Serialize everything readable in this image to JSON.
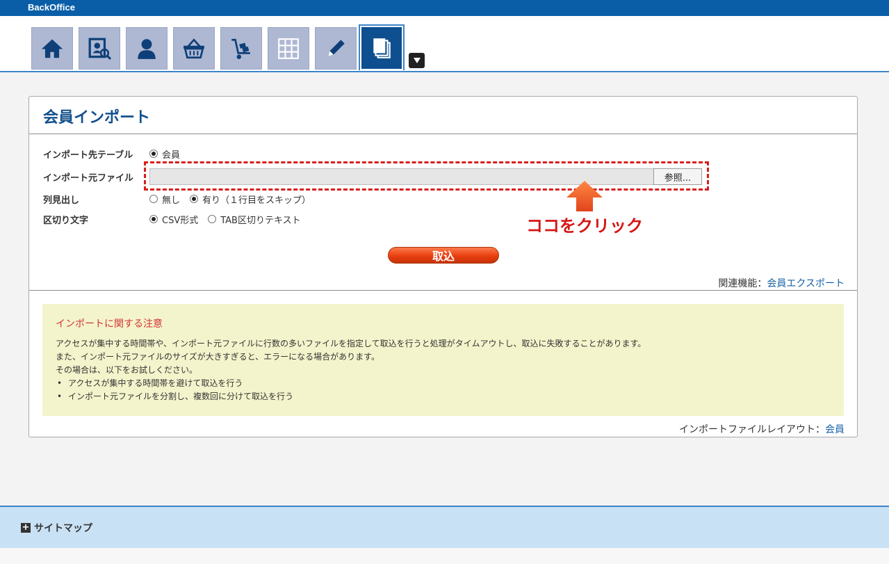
{
  "app": {
    "brand": "BackOffice"
  },
  "toolbar": {
    "icons": [
      "home-icon",
      "member-search-icon",
      "person-icon",
      "basket-icon",
      "cart-icon",
      "grid-icon",
      "pencil-icon",
      "documents-icon"
    ],
    "active": "documents-icon"
  },
  "page": {
    "title": "会員インポート"
  },
  "form": {
    "table_label": "インポート先テーブル",
    "table_option": "会員",
    "file_label": "インポート元ファイル",
    "file_value": "",
    "browse_label": "参照...",
    "header_label": "列見出し",
    "header_options": {
      "none": "無し",
      "yes": "有り（１行目をスキップ）"
    },
    "header_selected": "yes",
    "delim_label": "区切り文字",
    "delim_options": {
      "csv": "CSV形式",
      "tab": "TAB区切りテキスト"
    },
    "delim_selected": "csv",
    "submit_label": "取込"
  },
  "annotation": {
    "text": "ココをクリック",
    "color": "#d51515"
  },
  "related": {
    "prefix": "関連機能：",
    "link": "会員エクスポート"
  },
  "notice": {
    "title": "インポートに関する注意",
    "lines": [
      "アクセスが集中する時間帯や、インポート元ファイルに行数の多いファイルを指定して取込を行うと処理がタイムアウトし、取込に失敗することがあります。",
      "また、インポート元ファイルのサイズが大きすぎると、エラーになる場合があります。",
      "その場合は、以下をお試しください。"
    ],
    "bullets": [
      "アクセスが集中する時間帯を避けて取込を行う",
      "インポート元ファイルを分割し、複数回に分けて取込を行う"
    ]
  },
  "layout_link": {
    "prefix": "インポートファイルレイアウト：",
    "link": "会員"
  },
  "footer": {
    "sitemap": "サイトマップ"
  }
}
